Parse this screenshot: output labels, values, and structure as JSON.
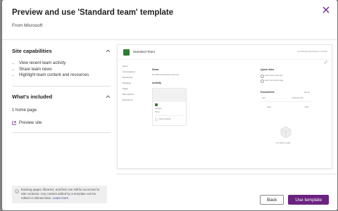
{
  "dialog": {
    "title": "Preview and use 'Standard team' template",
    "subtitle": "From Microsoft"
  },
  "capabilities": {
    "heading": "Site capabilities",
    "items": [
      "View recent team activity",
      "Share team news",
      "Highlight team content and resources"
    ]
  },
  "included": {
    "heading": "What's included",
    "text": "1 home page",
    "preview_link": "Preview site"
  },
  "notice": {
    "text": "Existing pages, libraries, and lists can still be accessed in Site contents. Any content added by a template can be edited or deleted later.",
    "link": "Learn more"
  },
  "preview": {
    "site_name": "Standard Team",
    "top_actions": "Not following    Site Settings    1 member",
    "nav": [
      "Home",
      "Conversations",
      "Documents",
      "Notebook",
      "Pages",
      "Site contents",
      "Recycle bin"
    ],
    "news_heading": "News",
    "news_text": "We didn't find anything to show here",
    "activity_heading": "Activity",
    "card_line1": "Activities",
    "card_line2": "Home",
    "card_line3": "Patti Fernandez",
    "quick_links_heading": "Quick links",
    "quick_links": [
      "Learn about a team site",
      "Learn how to add a page"
    ],
    "see_all": "See all",
    "documents_heading": "Documents",
    "doc_new": "New",
    "doc_all_docs": "All Documents",
    "doc_column_name": "Name",
    "doc_column_modified": "Modi",
    "empty_text": "The folder is empty"
  },
  "buttons": {
    "back": "Back",
    "use": "Use template"
  },
  "colors": {
    "accent": "#6b2380",
    "close_icon": "#6b2380",
    "site_logo": "#2e7d32"
  }
}
